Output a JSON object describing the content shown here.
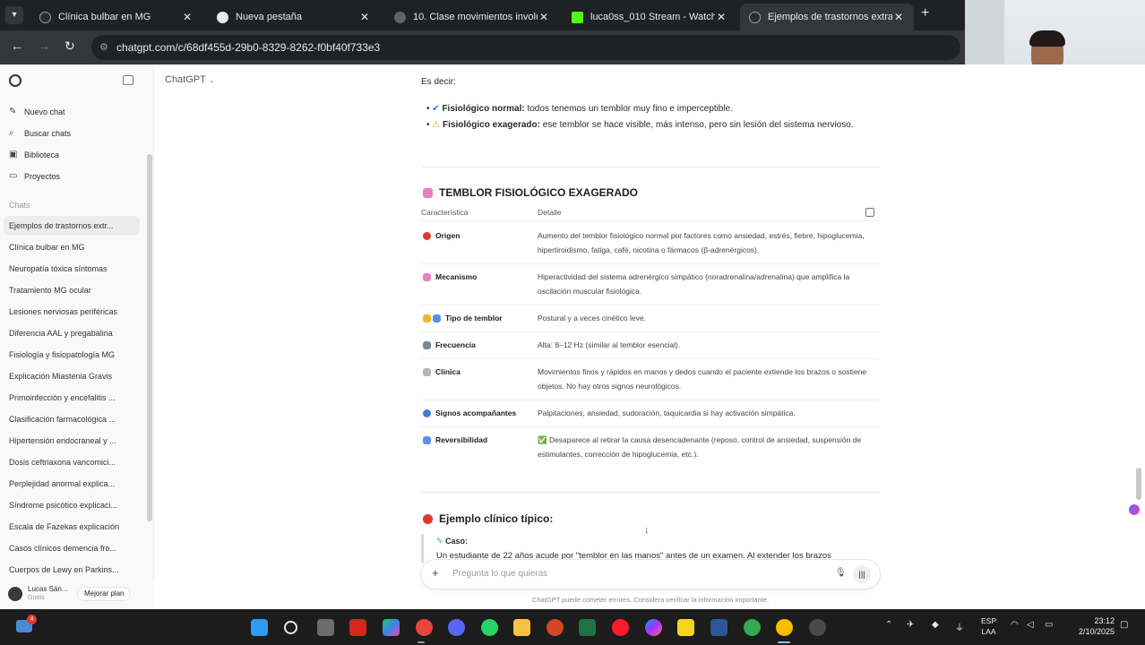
{
  "browser": {
    "tabs": [
      {
        "title": "Clínica bulbar en MG",
        "fav_color": "#2b2b2b",
        "active": false
      },
      {
        "title": "Nueva pestaña",
        "fav_color": "#e8eaed",
        "active": false
      },
      {
        "title": "10. Clase movimientos involunt",
        "fav_color": "#5f6368",
        "active": false
      },
      {
        "title": "luca0ss_010 Stream - Watch Li",
        "fav_color": "#53fc18",
        "active": false
      },
      {
        "title": "Ejemplos de trastornos extrapi",
        "fav_color": "#2b2b2b",
        "active": true
      }
    ],
    "new_tab": "+",
    "url": "chatgpt.com/c/68df455d-29b0-8329-8262-f0bf40f733e3"
  },
  "sidebar": {
    "actions": [
      {
        "icon": "new-chat-icon",
        "glyph": "✎",
        "label": "Nuevo chat"
      },
      {
        "icon": "search-icon",
        "glyph": "⌕",
        "label": "Buscar chats"
      },
      {
        "icon": "library-icon",
        "glyph": "▣",
        "label": "Biblioteca"
      },
      {
        "icon": "projects-icon",
        "glyph": "▭",
        "label": "Proyectos"
      }
    ],
    "section_label": "Chats",
    "chats": [
      "Ejemplos de trastornos extr...",
      "Clínica bulbar en MG",
      "Neuropatía tóxica síntomas",
      "Tratamiento MG ocular",
      "Lesiones nerviosas periféricas",
      "Diferencia AAL y pregabalina",
      "Fisiología y fisiopatología MG",
      "Explicación Miastenia Gravis",
      "Primoinfección y encefalitis ...",
      "Clasificación farmacológica ...",
      "Hipertensión endocraneal y ...",
      "Dosis ceftriaxona vancomici...",
      "Perplejidad anormal explica...",
      "Síndrome psicótico explicaci...",
      "Escala de Fazekas explicación",
      "Casos clínicos demencia fro...",
      "Cuerpos de Lewy en Parkins..."
    ],
    "user_name": "Lucas Sán...",
    "user_plan": "Gratis",
    "upgrade_label": "Mejorar plan"
  },
  "main": {
    "model_label": "ChatGPT",
    "intro": "Es decir:",
    "bullets": [
      {
        "marker": "✔",
        "bold": "Fisiológico normal:",
        "text": " todos tenemos un temblor muy fino e imperceptible."
      },
      {
        "marker": "⚠",
        "bold": "Fisiológico exagerado:",
        "text": " ese temblor se hace visible, más intenso, pero sin lesión del sistema nervioso."
      }
    ],
    "section_title": "TEMBLOR FISIOLÓGICO EXAGERADO",
    "table": {
      "headers": [
        "Característica",
        "Detalle"
      ],
      "rows": [
        {
          "feature": "Origen",
          "detail": "Aumento del temblor fisiológico normal por factores como ansiedad, estrés, fiebre, hipoglucemia, hipertiroidismo, fatiga, café, nicotina o fármacos (β-adrenérgicos)."
        },
        {
          "feature": "Mecanismo",
          "detail": "Hiperactividad del sistema adrenérgico simpático (noradrenalina/adrenalina) que amplifica la oscilación muscular fisiológica."
        },
        {
          "feature": "Tipo de temblor",
          "detail": "Postural y a veces cinético leve."
        },
        {
          "feature": "Frecuencia",
          "detail": "Alta: 8–12 Hz (similar al temblor esencial)."
        },
        {
          "feature": "Clínica",
          "detail": "Movimientos finos y rápidos en manos y dedos cuando el paciente extiende los brazos o sostiene objetos. No hay otros signos neurológicos."
        },
        {
          "feature": "Signos acompañantes",
          "detail": "Palpitaciones, ansiedad, sudoración, taquicardia si hay activación simpática."
        },
        {
          "feature": "Reversibilidad",
          "detail": "✅ Desaparece al retirar la causa desencadenante (reposo, control de ansiedad, suspensión de estimulantes, corrección de hipoglucemia, etc.)."
        }
      ]
    },
    "example_title": "Ejemplo clínico típico:",
    "case_label": "Caso:",
    "case_text": "Un estudiante de 22 años acude por \"temblor en las manos\" antes de un examen. Al extender los brazos",
    "composer_placeholder": "Pregunta lo que quieras",
    "disclaimer": "ChatGPT puede cometer errores. Considera verificar la información importante."
  },
  "taskbar": {
    "weather_badge": "4",
    "language": "ESP",
    "layout": "LAA",
    "time": "23:12",
    "date": "2/10/2025"
  },
  "colors": {
    "accent_red": "#e0362b",
    "chrome_dark": "#202124"
  }
}
